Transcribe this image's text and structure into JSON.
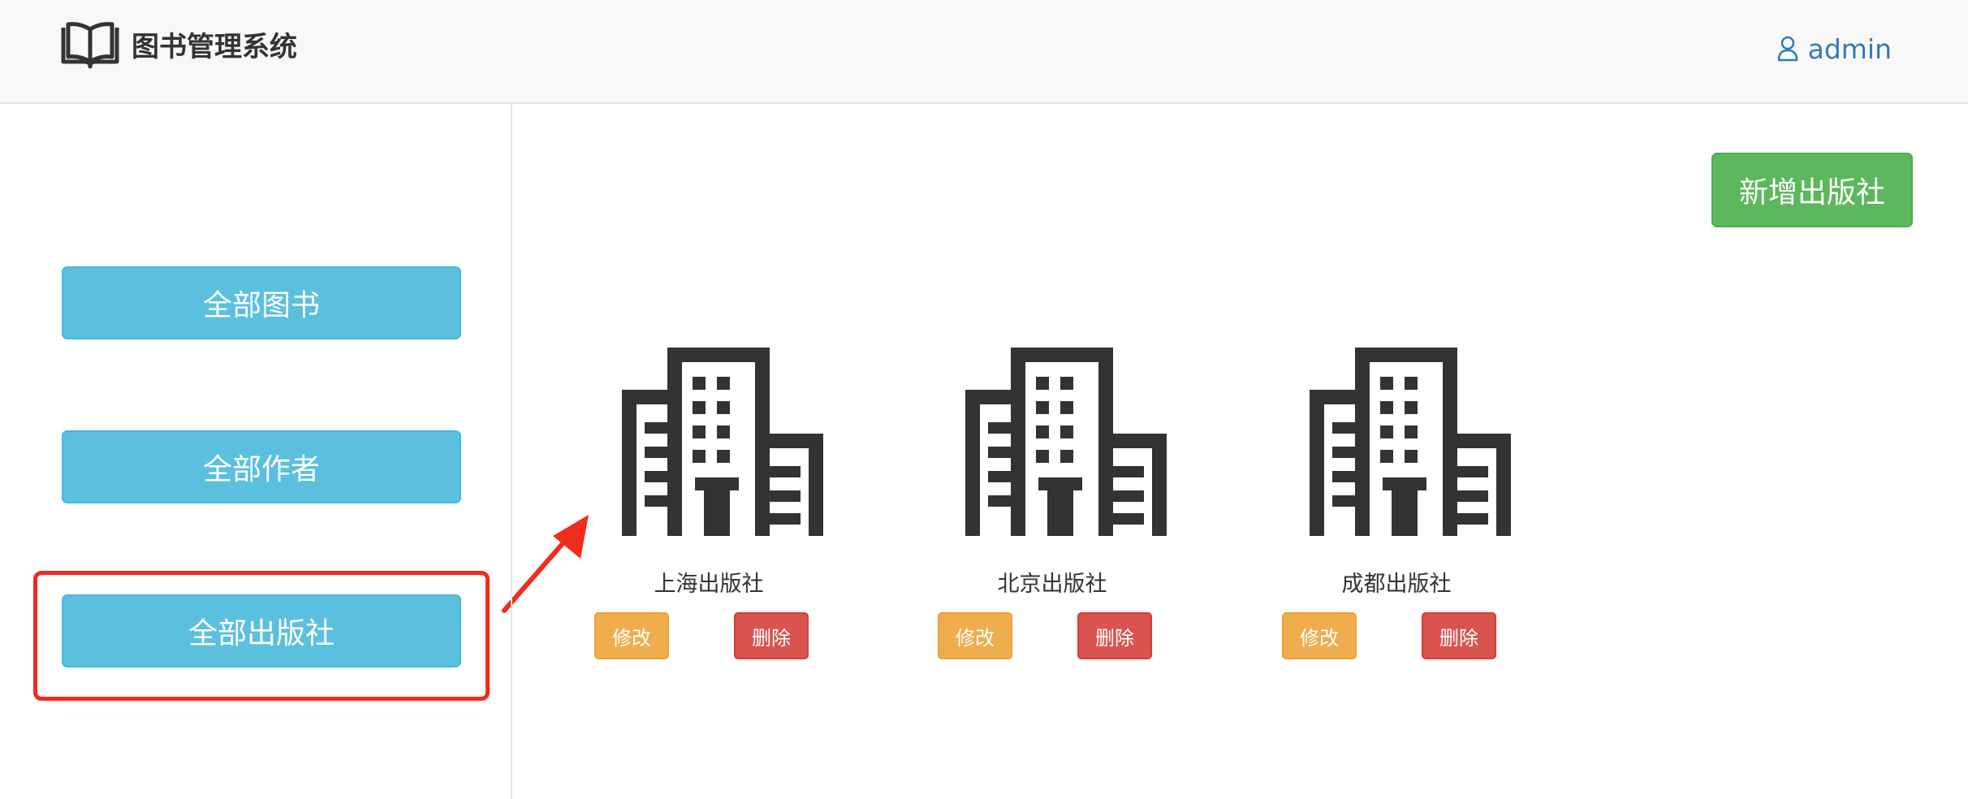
{
  "header": {
    "brand": "图书管理系统",
    "logo_icon": "open-book-icon",
    "user_icon": "user-icon",
    "username": "admin"
  },
  "sidebar": {
    "items": [
      {
        "label": "全部图书"
      },
      {
        "label": "全部作者"
      },
      {
        "label": "全部出版社",
        "highlighted": true
      }
    ]
  },
  "main": {
    "add_button": "新增出版社",
    "publisher_icon": "building-icon",
    "publishers": [
      {
        "name": "上海出版社",
        "edit_label": "修改",
        "delete_label": "删除"
      },
      {
        "name": "北京出版社",
        "edit_label": "修改",
        "delete_label": "删除"
      },
      {
        "name": "成都出版社",
        "edit_label": "修改",
        "delete_label": "删除"
      }
    ]
  },
  "colors": {
    "sidebar_button": "#5bc0de",
    "add_button": "#5cb85c",
    "edit_button": "#f0ad4e",
    "delete_button": "#d9534f",
    "annotation": "#f02c1c",
    "user_link": "#337ab7"
  }
}
